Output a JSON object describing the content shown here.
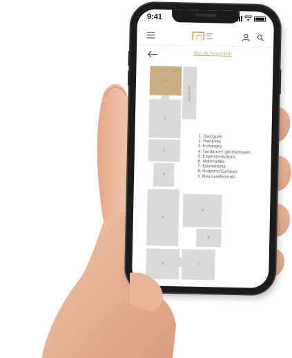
{
  "status_bar": {
    "time": "9:41"
  },
  "header": {
    "menu_icon": "hamburger-icon",
    "logo_icon": "museum-logo",
    "user_icon": "user-icon",
    "search_icon": "search-icon"
  },
  "nav": {
    "back_icon": "arrow-left-icon",
    "title": "plan de l'exposition"
  },
  "floor_plan": {
    "rooms": [
      {
        "number": "1",
        "active": true
      },
      {
        "number": "2",
        "active": false
      },
      {
        "number": "3",
        "active": false
      },
      {
        "number": "4",
        "active": false
      },
      {
        "number": "5",
        "active": false
      },
      {
        "number": "6",
        "active": false
      },
      {
        "number": "7",
        "active": false
      },
      {
        "number": "8",
        "active": false
      },
      {
        "number": "9",
        "active": false
      }
    ],
    "intro_label": "Introduction",
    "legend": [
      "1. Dialogues",
      "2. Peintures",
      "3. Echanges",
      "4. Tendances géométriques",
      "5. Expérimentations",
      "6. Matérialités",
      "7. Epurements",
      "8. Supports/Surfaces",
      "9. Renouvellements"
    ]
  },
  "colors": {
    "accent": "#c8aa7a",
    "room_fill": "#d9d9d9",
    "active_room_fill": "#c9ae84"
  }
}
